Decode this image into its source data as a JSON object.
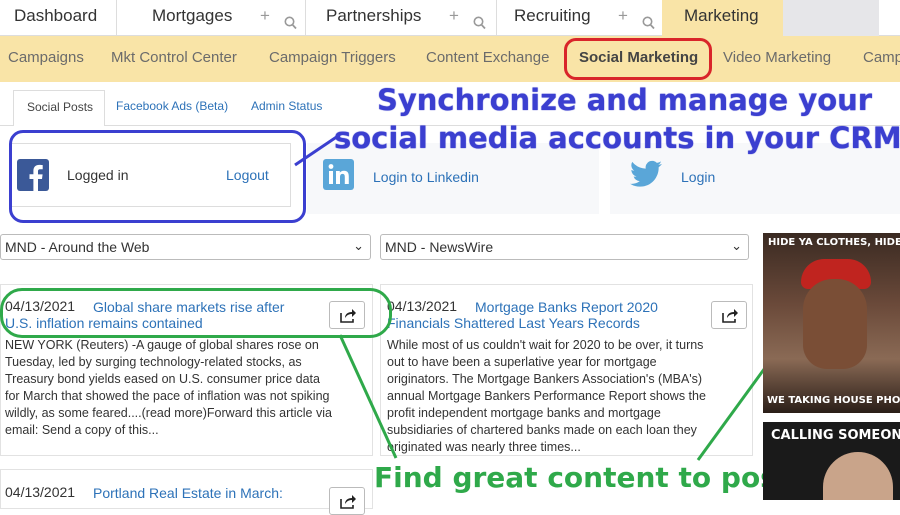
{
  "top_tabs": [
    {
      "label": "Dashboard"
    },
    {
      "label": "Mortgages"
    },
    {
      "label": "Partnerships"
    },
    {
      "label": "Recruiting"
    },
    {
      "label": "Marketing"
    }
  ],
  "top_tab_plus": "+",
  "subnav": [
    "Campaigns",
    "Mkt Control Center",
    "Campaign Triggers",
    "Content Exchange",
    "Social Marketing",
    "Video Marketing",
    "Camp"
  ],
  "inner_tabs": [
    "Social Posts",
    "Facebook Ads (Beta)",
    "Admin Status"
  ],
  "overlay": {
    "line1": "Synchronize and manage your",
    "line2": "social media accounts in your CRM!",
    "bottom": "Find great content to post"
  },
  "accounts": {
    "facebook": {
      "status": "Logged in",
      "action": "Logout"
    },
    "linkedin": {
      "action": "Login to Linkedin"
    },
    "twitter": {
      "action": "Login"
    }
  },
  "feeds": {
    "left": "MND - Around the Web",
    "right": "MND - NewsWire"
  },
  "chevron": "⌄",
  "articles": {
    "a1": {
      "date": "04/13/2021",
      "title_1": "Global share markets rise after",
      "title_2": "U.S. inflation remains contained",
      "body": [
        "NEW YORK (Reuters) -A gauge of global shares rose on",
        "Tuesday, led by surging technology-related stocks, as",
        "Treasury bond yields eased on U.S. consumer price data",
        "for March that showed the pace of inflation was not spiking",
        "wildly, as some feared....(read more)Forward this article via",
        "email:  Send a copy of this..."
      ]
    },
    "a2": {
      "date": "04/13/2021",
      "title_1": "Mortgage Banks Report 2020",
      "title_2": "Financials Shattered Last Years Records",
      "body": [
        "While most of us couldn't wait for 2020 to be over, it turns",
        "out to have been a superlative year for mortgage",
        "originators. The Mortgage Bankers Association's (MBA's)",
        "annual Mortgage Bankers Performance Report shows the",
        "profit independent mortgage banks and mortgage",
        "subsidiaries of chartered banks made on each loan they",
        "originated was nearly three times..."
      ]
    },
    "a3": {
      "date": "04/13/2021",
      "title_1": "Portland Real Estate in March:"
    }
  },
  "ads": {
    "ad1_top": "HIDE YA CLOTHES, HIDE YA",
    "ad1_bottom": "WE TAKING HOUSE PHOTOS",
    "ad2_top": "CALLING SOMEONE"
  },
  "colors": {
    "marketing_tab": "#f9e4a7",
    "link_blue": "#2d72b8",
    "annotation_blue": "#3b3fd0",
    "annotation_green": "#2fa94a",
    "annotation_red": "#d9252a"
  }
}
